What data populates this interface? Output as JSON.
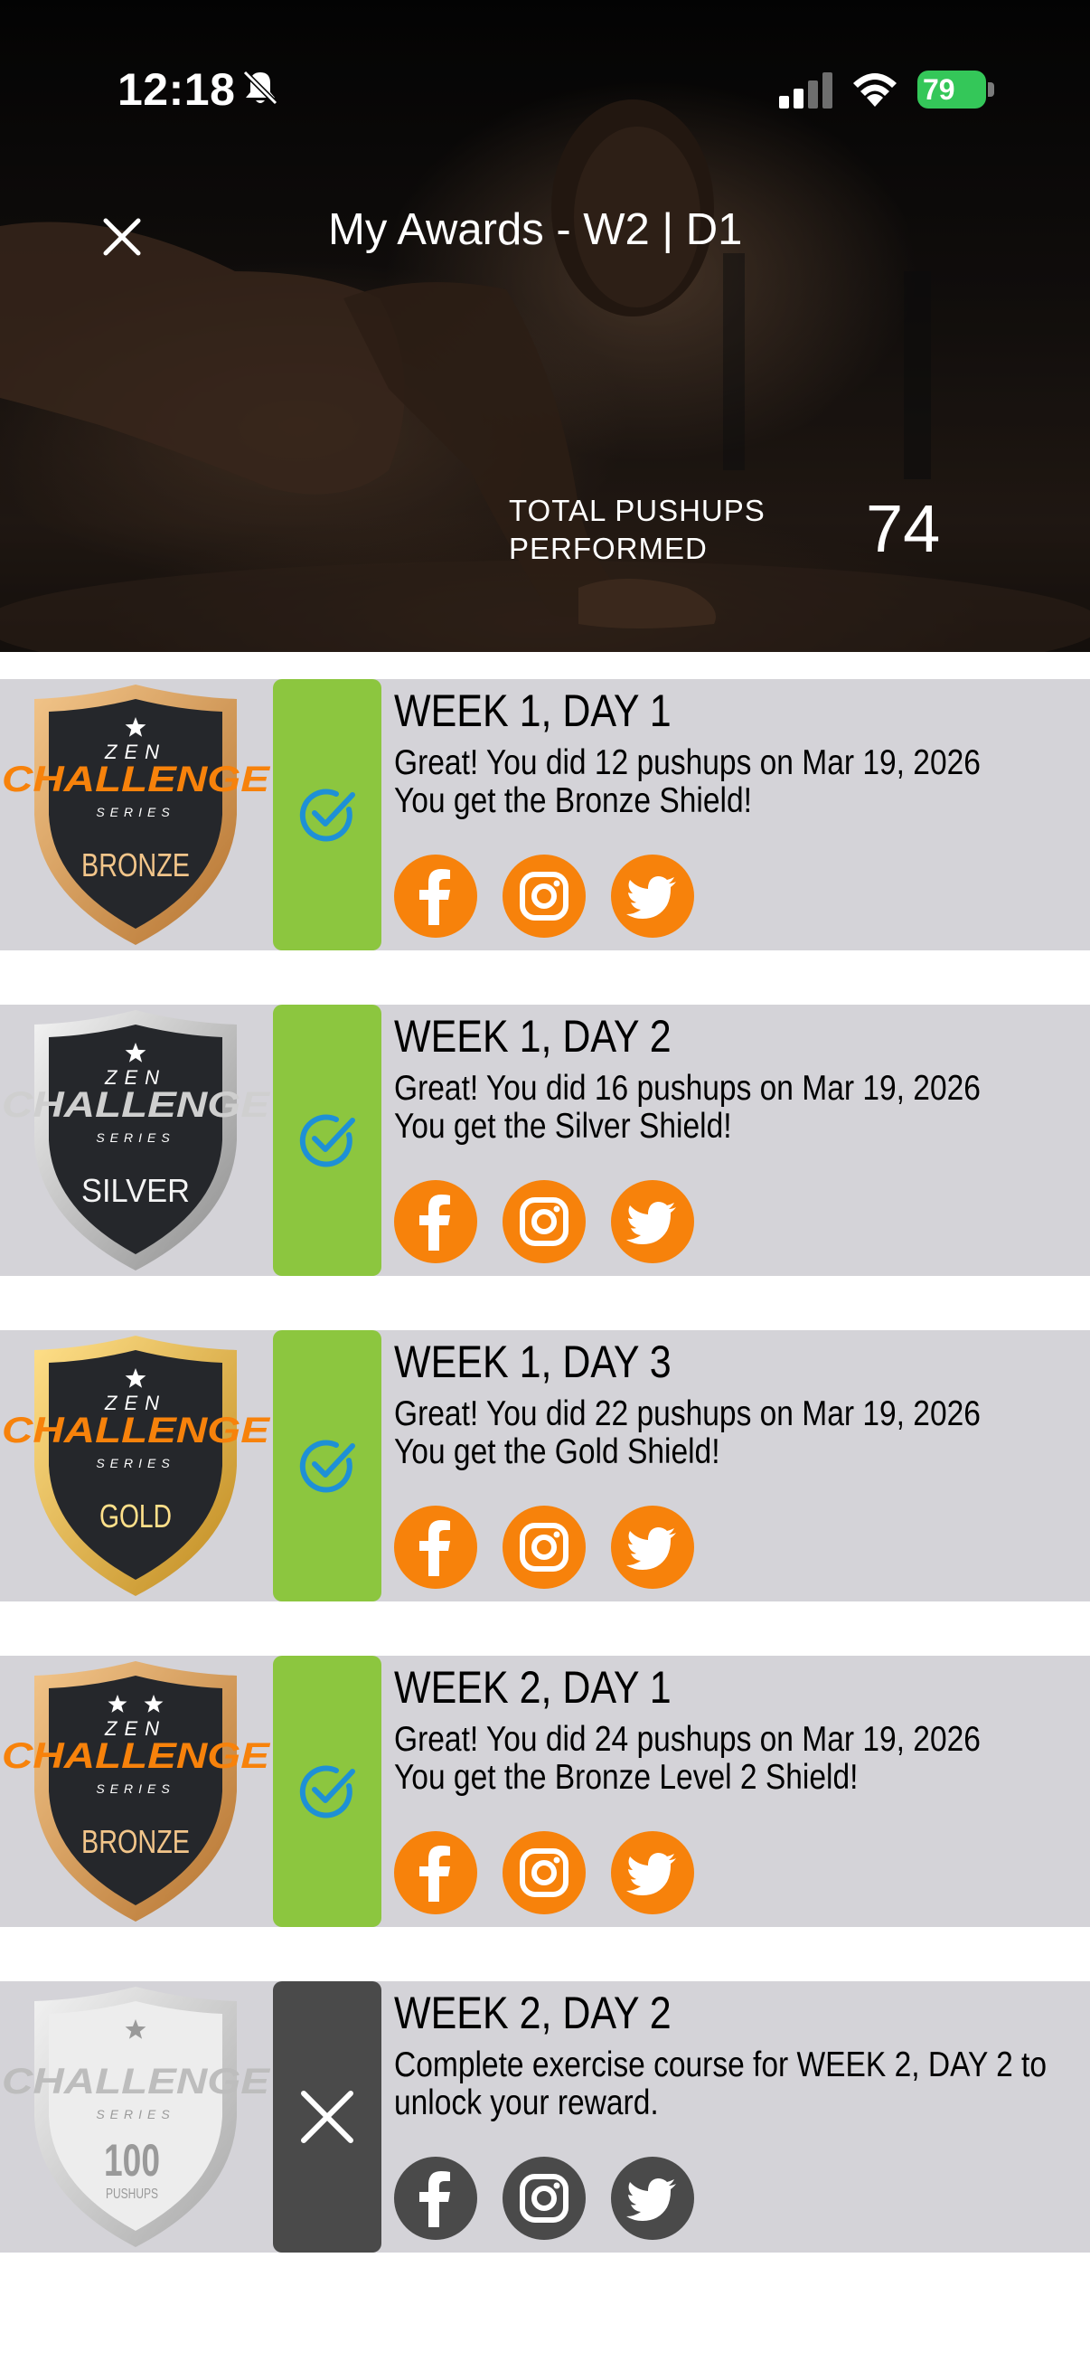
{
  "status_bar": {
    "time": "12:18",
    "battery": "79"
  },
  "header": {
    "title": "My Awards - W2 | D1",
    "total_label": "TOTAL PUSHUPS PERFORMED",
    "total_value": "74"
  },
  "colors": {
    "completed_strip": "#8cc63f",
    "locked_strip": "#4a4a4a",
    "social_active": "#f7820b",
    "social_locked": "#4a4a4a",
    "row_background": "#d4d3d8",
    "check_blue": "#1e90d6"
  },
  "awards": [
    {
      "title": "WEEK 1, DAY 1",
      "line1": "Great! You did 12 pushups on Mar 19, 2026",
      "line2": "You get the Bronze Shield!",
      "completed": true,
      "badge": {
        "top": "ZEN",
        "middle": "CHALLENGE",
        "series": "SERIES",
        "level": "BRONZE",
        "stars": 1,
        "icon": "bronze-shield-icon"
      }
    },
    {
      "title": "WEEK 1, DAY 2",
      "line1": "Great! You did 16 pushups on Mar 19, 2026",
      "line2": "You get the Silver Shield!",
      "completed": true,
      "badge": {
        "top": "ZEN",
        "middle": "CHALLENGE",
        "series": "SERIES",
        "level": "SILVER",
        "stars": 1,
        "icon": "silver-shield-icon"
      }
    },
    {
      "title": "WEEK 1, DAY 3",
      "line1": "Great! You did 22 pushups on Mar 19, 2026",
      "line2": "You get the Gold Shield!",
      "completed": true,
      "badge": {
        "top": "ZEN",
        "middle": "CHALLENGE",
        "series": "SERIES",
        "level": "GOLD",
        "stars": 1,
        "icon": "gold-shield-icon"
      }
    },
    {
      "title": "WEEK 2, DAY 1",
      "line1": "Great! You did 24 pushups on Mar 19, 2026",
      "line2": "You get the Bronze Level 2 Shield!",
      "completed": true,
      "badge": {
        "top": "ZEN",
        "middle": "CHALLENGE",
        "series": "SERIES",
        "level": "BRONZE",
        "stars": 2,
        "icon": "bronze-level-2-shield-icon"
      }
    },
    {
      "title": "WEEK 2, DAY 2",
      "line1": "Complete exercise course for WEEK 2, DAY 2 to unlock your reward.",
      "line2": "",
      "completed": false,
      "badge": {
        "top": "",
        "middle": "CHALLENGE",
        "series": "SERIES",
        "level": "100",
        "sublevel": "PUSHUPS",
        "stars": 1,
        "icon": "locked-shield-icon"
      }
    }
  ]
}
